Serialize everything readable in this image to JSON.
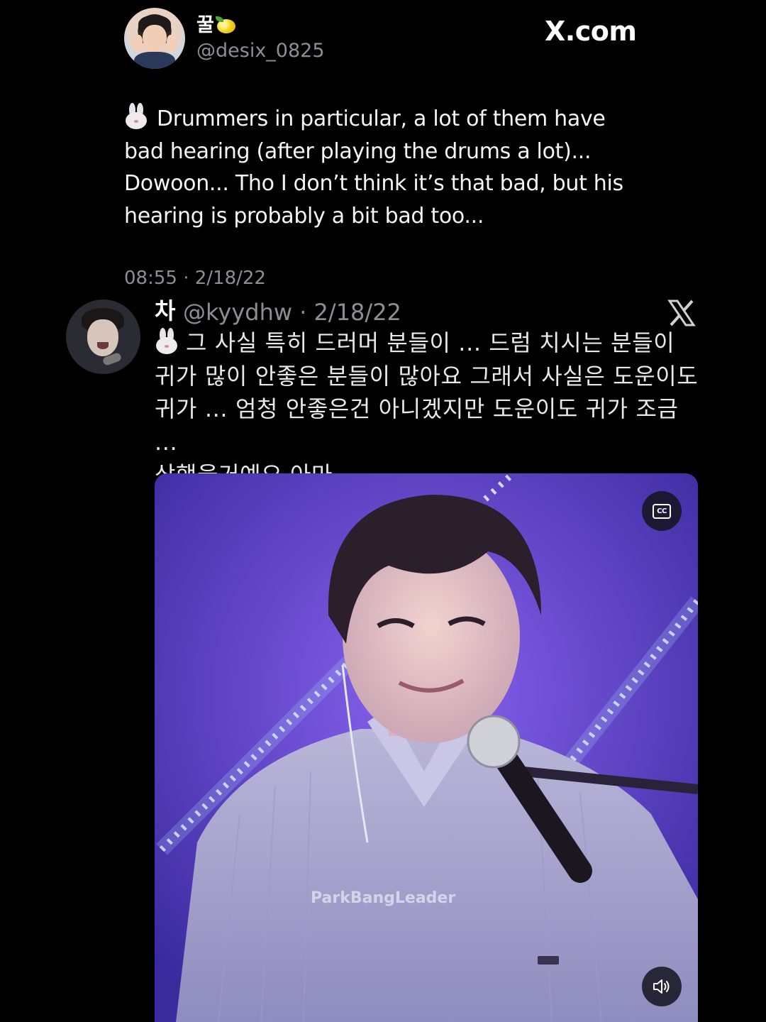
{
  "header": {
    "display_name": "꿀",
    "handle": "@desix_0825",
    "brand": "X.com"
  },
  "tweet": {
    "lines": [
      "Drummers in particular, a lot of them have",
      "bad hearing (after playing the drums a lot)...",
      "Dowoon... Tho I don’t think it’s that bad, but his",
      "hearing is probably a bit bad too..."
    ],
    "timestamp": "08:55 · 2/18/22"
  },
  "quoted": {
    "name": "차",
    "handle_date": "@kyydhw · 2/18/22",
    "lines": [
      "그 사실 특히 드러머 분들이 ... 드럼 치시는 분들이",
      "귀가 많이 안좋은 분들이 많아요 그래서 사실은 도운이도",
      "귀가 ... 엄청 안좋은건 아니겠지만 도운이도 귀가 조금 ...",
      "상했을거예요 아마"
    ],
    "media": {
      "watermark": "ParkBangLeader",
      "cc_label": "CC"
    }
  },
  "icons": {
    "emoji_after_name": "lemon-icon",
    "tweet_prefix": "rabbit-icon",
    "quote_logo": "x-logo-icon",
    "media_captions": "closed-captions-icon",
    "media_sound": "speaker-icon"
  },
  "colors": {
    "background": "#000000",
    "primary_text": "#f5f5f5",
    "secondary_text": "#8b8f94",
    "media_purple": "#6a3fd8"
  }
}
